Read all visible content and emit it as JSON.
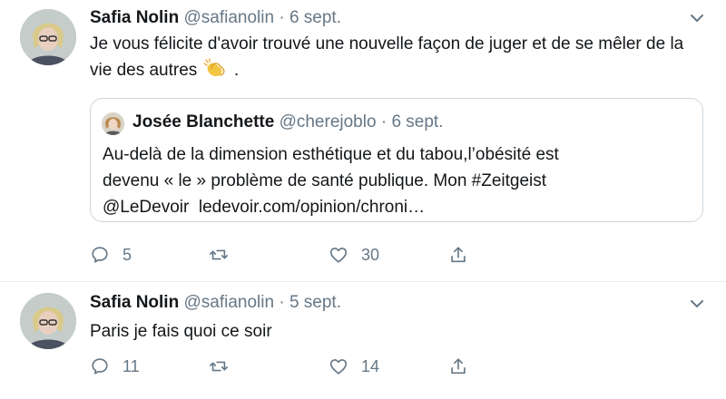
{
  "tweets": [
    {
      "name": "Safia Nolin",
      "handle": "@safianolin",
      "separator": "·",
      "date": "6 sept.",
      "text": "Je vous félicite d'avoir trouvé une nouvelle façon de juger et de se mêler de la vie des autres",
      "emoji": "clapping-hands-emoji",
      "quote": {
        "name": "Josée Blanchette",
        "handle": "@cherejoblo",
        "separator": "·",
        "date": "6 sept.",
        "text_line1": "Au-delà de la dimension esthétique et du tabou,l’obésité est",
        "text_line2": "devenu « le » problème de santé publique. Mon #Zeitgeist",
        "text_line3": "@LeDevoir  ledevoir.com/opinion/chroni…"
      },
      "actions": {
        "replies": "5",
        "retweets": "",
        "likes": "30"
      }
    },
    {
      "name": "Safia Nolin",
      "handle": "@safianolin",
      "separator": "·",
      "date": "5 sept.",
      "text": "Paris je fais quoi ce soir",
      "actions": {
        "replies": "11",
        "retweets": "",
        "likes": "14"
      }
    }
  ],
  "colors": {
    "text": "#14171a",
    "secondary": "#657786",
    "border": "#ccd6dd",
    "divider": "#e6ecf0"
  },
  "icons": [
    "reply-icon",
    "retweet-icon",
    "like-icon",
    "share-icon",
    "chevron-down-icon"
  ]
}
